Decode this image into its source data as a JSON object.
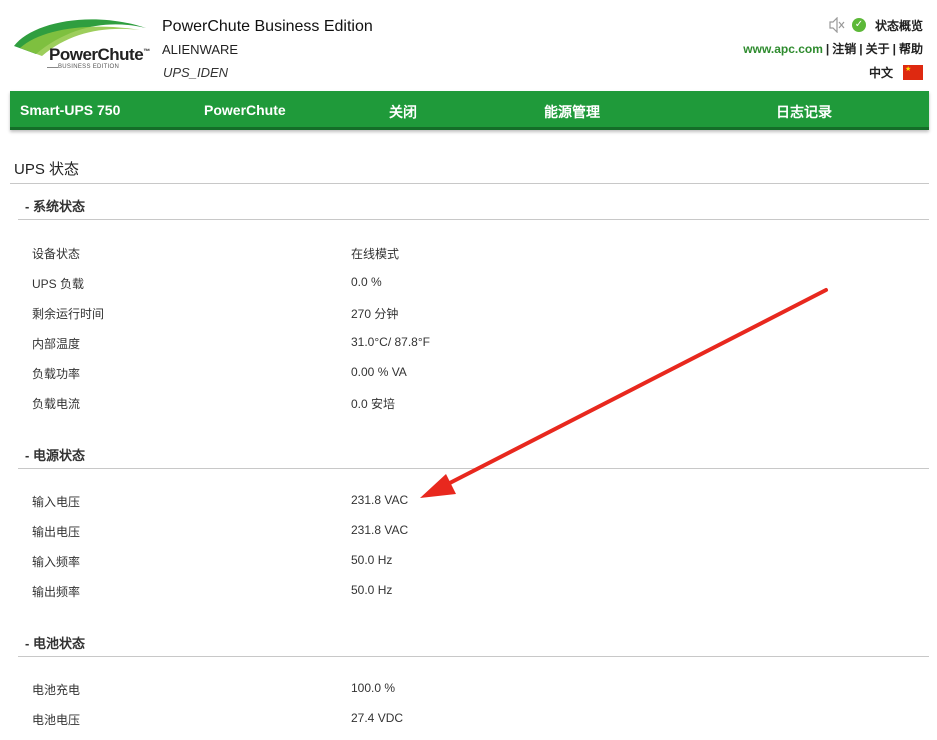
{
  "header": {
    "logo_text": "PowerChute",
    "logo_tm": "™",
    "logo_sub": "BUSINESS EDITION",
    "app_title": "PowerChute Business Edition",
    "host_name": "ALIENWARE",
    "ups_id": "UPS_IDEN",
    "status_overview": "状态概览",
    "apc_link": "www.apc.com",
    "logout": "注销",
    "about": "关于",
    "help": "帮助",
    "separator": "|",
    "language": "中文"
  },
  "nav": {
    "items": [
      "Smart-UPS 750",
      "PowerChute",
      "关闭",
      "能源管理",
      "日志记录"
    ]
  },
  "page_title": "UPS 状态",
  "sections": [
    {
      "title": "- 系统状态",
      "rows": [
        {
          "label": "设备状态",
          "value": "在线模式"
        },
        {
          "label": "UPS 负载",
          "value": "0.0 %"
        },
        {
          "label": "剩余运行时间",
          "value": "270 分钟"
        },
        {
          "label": "内部温度",
          "value": "31.0°C/ 87.8°F"
        },
        {
          "label": "负载功率",
          "value": "0.00 % VA"
        },
        {
          "label": "负载电流",
          "value": "0.0 安培"
        }
      ]
    },
    {
      "title": "- 电源状态",
      "rows": [
        {
          "label": "输入电压",
          "value": "231.8 VAC"
        },
        {
          "label": "输出电压",
          "value": "231.8 VAC"
        },
        {
          "label": "输入频率",
          "value": "50.0 Hz"
        },
        {
          "label": "输出频率",
          "value": "50.0 Hz"
        }
      ]
    },
    {
      "title": "- 电池状态",
      "rows": [
        {
          "label": "电池充电",
          "value": "100.0 %"
        },
        {
          "label": "电池电压",
          "value": "27.4 VDC"
        }
      ]
    }
  ],
  "colors": {
    "brand_green": "#1f9a3a",
    "annotation_arrow": "#e8281e"
  }
}
